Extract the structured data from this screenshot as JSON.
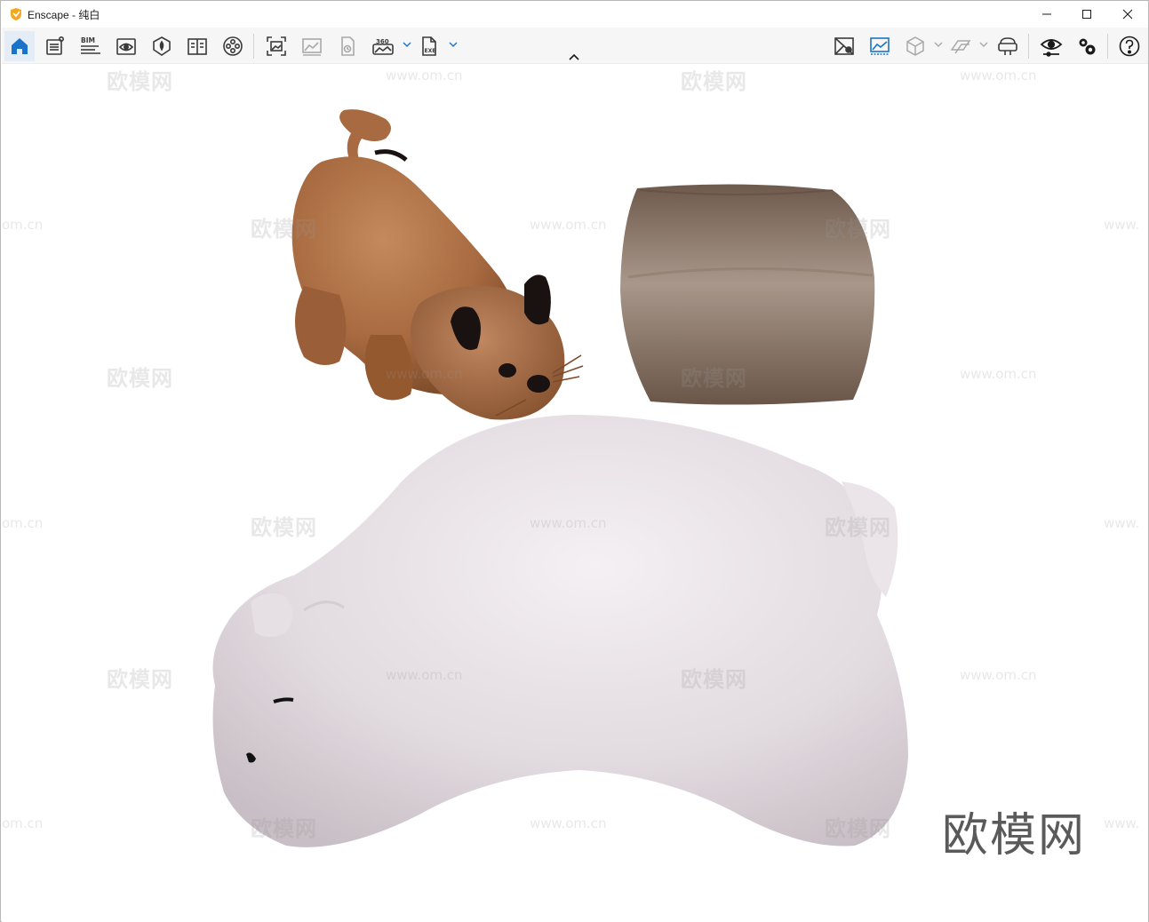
{
  "window": {
    "title": "Enscape - 纯白"
  },
  "colors": {
    "logo_orange": "#f5a623",
    "active_blue": "#1a73c8",
    "icon_gray": "#3a3a3a",
    "disabled_gray": "#a8a8a8"
  },
  "toolbar": {
    "left_tools": [
      {
        "name": "home",
        "icon": "home-icon"
      },
      {
        "name": "asset-library",
        "icon": "asset-library-icon"
      },
      {
        "name": "bim",
        "icon": "bim-icon",
        "label": "BIM"
      },
      {
        "name": "views",
        "icon": "views-icon"
      },
      {
        "name": "material-editor",
        "icon": "material-editor-icon"
      },
      {
        "name": "object-info",
        "icon": "book-icon"
      },
      {
        "name": "video-editor",
        "icon": "film-reel-icon"
      }
    ],
    "capture_tools": [
      {
        "name": "screenshot",
        "icon": "screenshot-icon"
      },
      {
        "name": "batch-render",
        "icon": "batch-image-icon"
      },
      {
        "name": "render-queue",
        "icon": "render-queue-icon"
      },
      {
        "name": "panorama",
        "icon": "panorama-360-icon",
        "label": "360"
      },
      {
        "name": "export-exe",
        "icon": "export-exe-icon",
        "label": "EXE"
      }
    ],
    "right_tools": [
      {
        "name": "minimap",
        "icon": "minimap-icon"
      },
      {
        "name": "atmosphere",
        "icon": "atmosphere-icon"
      },
      {
        "name": "orthographic",
        "icon": "cube-icon"
      },
      {
        "name": "section",
        "icon": "section-icon"
      },
      {
        "name": "vr-headset",
        "icon": "vr-headset-icon"
      },
      {
        "name": "visual-settings",
        "icon": "eye-settings-icon"
      },
      {
        "name": "general-settings",
        "icon": "gears-icon"
      },
      {
        "name": "help",
        "icon": "help-icon"
      }
    ]
  },
  "viewport": {
    "watermark_cn": "欧模网",
    "watermark_url": "www.om.cn",
    "watermark_url_partial": "om.cn",
    "watermark_url_edge": "www.",
    "corner_logo": "欧模网"
  }
}
